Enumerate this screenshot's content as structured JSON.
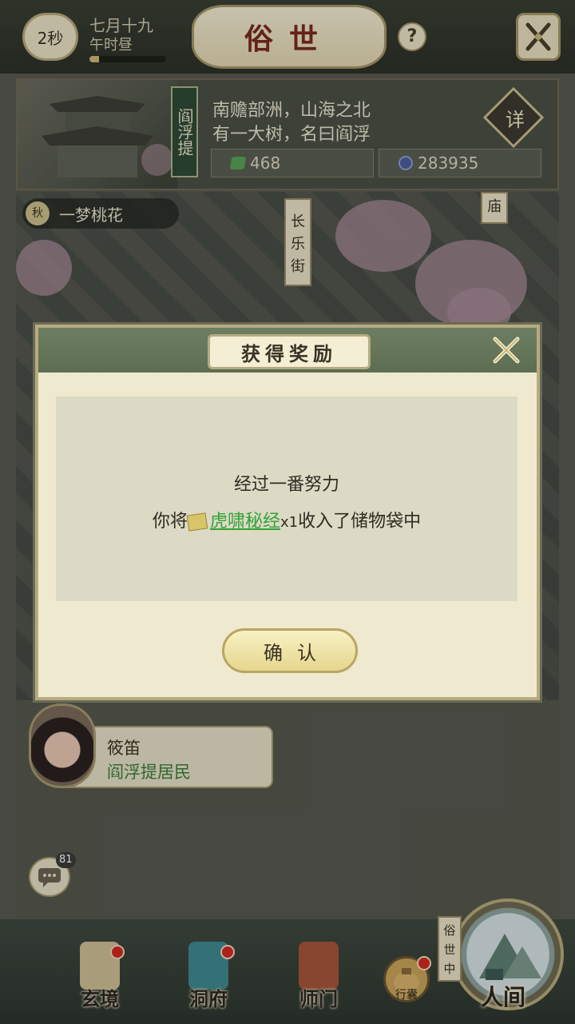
{
  "topbar": {
    "timer": "2秒",
    "date_line1": "七月十九",
    "date_line2": "午时昼",
    "date_progress": 0.12,
    "title": "俗世",
    "help": "?"
  },
  "location": {
    "name": "阎浮提",
    "desc_line1": "南赡部洲，山海之北",
    "desc_line2": "有一大树，名曰阎浮",
    "detail_button": "详",
    "resource_green": "468",
    "resource_blue": "283935"
  },
  "map": {
    "season_badge": "秋",
    "season_text": "一梦桃花",
    "street_sign": "长乐街",
    "temple_sign": "庙"
  },
  "modal": {
    "title": "获得奖励",
    "line1": "经过一番努力",
    "line2_prefix": "你将",
    "item_name": "虎啸秘经",
    "item_qty": "x1",
    "line2_suffix": "收入了储物袋中",
    "confirm": "确认"
  },
  "character": {
    "name": "筱笛",
    "role": "阎浮提居民"
  },
  "chat": {
    "badge": "81"
  },
  "bottom_nav": {
    "items": [
      {
        "label": "玄境"
      },
      {
        "label": "洞府"
      },
      {
        "label": "师门"
      }
    ],
    "bag_label": "行囊",
    "world_tag": "俗世中",
    "world_label": "人间"
  },
  "colors": {
    "accent_green": "#32a33a",
    "modal_header": "#6d7e62",
    "red_dot": "#d22a1e",
    "title_red": "#7a2a20"
  },
  "icons": [
    "close-icon",
    "gem-icon",
    "spirit-coin-icon",
    "scroll-item-icon",
    "chat-icon",
    "bag-icon"
  ]
}
